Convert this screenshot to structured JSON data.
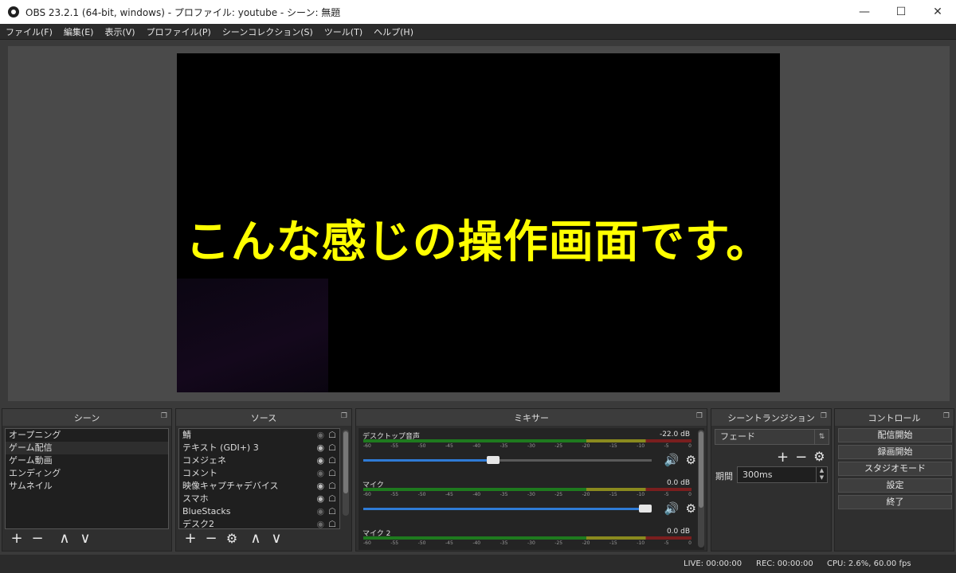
{
  "window": {
    "title": "OBS 23.2.1 (64-bit, windows) - プロファイル: youtube - シーン: 無題"
  },
  "menu": [
    "ファイル(F)",
    "編集(E)",
    "表示(V)",
    "プロファイル(P)",
    "シーンコレクション(S)",
    "ツール(T)",
    "ヘルプ(H)"
  ],
  "preview": {
    "caption": "こんな感じの操作画面です。"
  },
  "scenes": {
    "title": "シーン",
    "items": [
      "オープニング",
      "ゲーム配信",
      "ゲーム動画",
      "エンディング",
      "サムネイル"
    ],
    "selected_index": 1
  },
  "sources": {
    "title": "ソース",
    "items": [
      {
        "name": "鯖",
        "visible": false
      },
      {
        "name": "テキスト (GDI+) 3",
        "visible": true
      },
      {
        "name": "コメジェネ",
        "visible": true
      },
      {
        "name": "コメント",
        "visible": false
      },
      {
        "name": "映像キャプチャデバイス",
        "visible": true
      },
      {
        "name": "スマホ",
        "visible": true
      },
      {
        "name": "BlueStacks",
        "visible": false
      },
      {
        "name": "デスク2",
        "visible": false
      }
    ]
  },
  "mixer": {
    "title": "ミキサー",
    "ticks": [
      "-60",
      "-55",
      "-50",
      "-45",
      "-40",
      "-35",
      "-30",
      "-25",
      "-20",
      "-15",
      "-10",
      "-5",
      "0"
    ],
    "channels": [
      {
        "name": "デスクトップ音声",
        "db": "-22.0 dB",
        "level": 0.45
      },
      {
        "name": "マイク",
        "db": "0.0 dB",
        "level": 1.0
      },
      {
        "name": "マイク 2",
        "db": "0.0 dB",
        "level": 1.0
      }
    ]
  },
  "transitions": {
    "title": "シーントランジション",
    "selected": "フェード",
    "duration_label": "期間",
    "duration_value": "300ms"
  },
  "controls": {
    "title": "コントロール",
    "buttons": [
      "配信開始",
      "録画開始",
      "スタジオモード",
      "設定",
      "終了"
    ]
  },
  "status": {
    "live": "LIVE: 00:00:00",
    "rec": "REC: 00:00:00",
    "cpu": "CPU: 2.6%, 60.00 fps"
  }
}
